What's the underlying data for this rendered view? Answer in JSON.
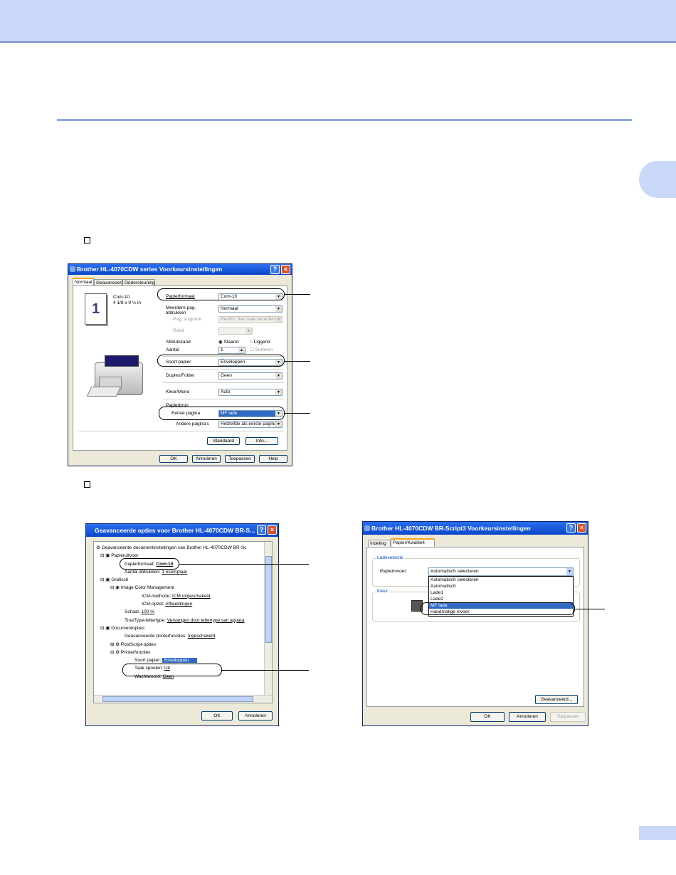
{
  "win1": {
    "title": "Brother HL-4070CDW series Voorkeursinstellingen",
    "tabs": [
      "Normaal",
      "Geavanceerd",
      "Ondersteuning"
    ],
    "preview_number": "1",
    "paper_name": "Com-10",
    "paper_dims": "4 1/8 x 9 ½ in",
    "labels": {
      "papierformaat": "Papierformaat",
      "meerdere": "Meerdere pag.",
      "afdrukken": "afdrukken",
      "pagvolgorde": "Pag. volgorde",
      "rand": "Rand",
      "afdrukstand": "Afdrukstand",
      "aantal": "Aantal",
      "soortpapier": "Soort papier",
      "duplex": "Duplex/Folder",
      "kleur": "Kleur/Mono",
      "papierbron": "Papierbron",
      "eerste": "Eerste pagina",
      "andere": "Andere pagina's"
    },
    "values": {
      "papierformaat": "Com-10",
      "meerdere": "Normaal",
      "pagvolgorde": "Rechts, dan naar beneden",
      "rand": "",
      "staand": "Staand",
      "liggend": "Liggend",
      "aantal": "1",
      "sorteren": "Sorteren",
      "soortpapier": "Enveloppen",
      "duplex": "Geen",
      "kleur": "Auto",
      "eerste": "MF lade",
      "andere": "Hetzelfde als eerste pagina"
    },
    "buttons": {
      "standaard": "Standaard",
      "info": "Info...",
      "ok": "OK",
      "annuleren": "Annuleren",
      "toepassen": "Toepassen",
      "help": "Help"
    }
  },
  "win2": {
    "title": "Geavanceerde opties voor Brother HL-4070CDW BR-S...",
    "tree": {
      "root": "Geavanceerde documentinstellingen van Brother HL-4070CDW BR-Sc",
      "papieruitvoer": "Papieruitvoer",
      "papierformaat_k": "Papierformaat:",
      "papierformaat_v": "Com-10",
      "aantal_k": "Aantal afdrukken:",
      "aantal_v": "1 exemplaar",
      "grafisch": "Grafisch",
      "icm": "Image Color Management",
      "icm_methode_k": "ICM-methode:",
      "icm_methode_v": "ICM uitgeschakeld",
      "icm_opzet_k": "ICM-opzet:",
      "icm_opzet_v": "Afbeeldingen",
      "schaal_k": "Schaal:",
      "schaal_v": "100 %",
      "truetype_k": "TrueType-lettertype:",
      "truetype_v": "Vervangen door lettertype van appara",
      "documentopties": "Documentopties",
      "geavanceerd_k": "Geavanceerde printerfuncties:",
      "geavanceerd_v": "Ingeschakeld",
      "postscript": "PostScript-opties",
      "printerfuncties": "Printerfuncties",
      "soort_k": "Soort papier:",
      "soort_v": "Enveloppen",
      "taak_k": "Taak spoolen:",
      "taak_v": "Uit",
      "wacht_k": "Wachtwoord:",
      "wacht_v": "Geen"
    },
    "buttons": {
      "ok": "OK",
      "annuleren": "Annuleren"
    }
  },
  "win3": {
    "title": "Brother HL-4070CDW BR-Script3 Voorkeursinstellingen",
    "tabs": [
      "Indeling",
      "Papier/Kwaliteit"
    ],
    "group_lade": "Ladeselectie",
    "papierinvoer_label": "Papierinvoer:",
    "papierinvoer_value": "Automatisch selecteren",
    "group_kleur": "Kleur",
    "dropdown": [
      "Automatisch selecteren",
      "Automatisch",
      "Lade1",
      "Lade2",
      "MF lade",
      "Handmatige invoer"
    ],
    "buttons": {
      "geavanceerd": "Geavanceerd...",
      "ok": "OK",
      "annuleren": "Annuleren",
      "toepassen": "Toepassen"
    }
  }
}
